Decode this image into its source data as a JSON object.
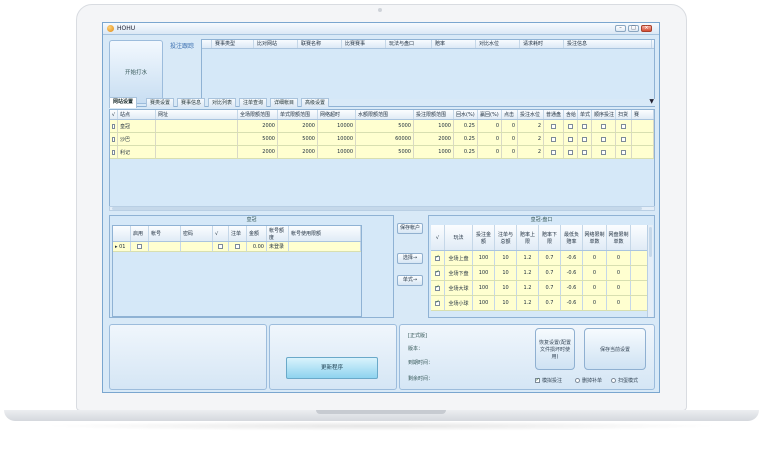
{
  "window": {
    "title": "HOHU",
    "minimize": "–",
    "maximize": "□",
    "close": "×"
  },
  "start_button": {
    "label": "开始打水"
  },
  "tracking": {
    "label": "投注跟踪",
    "columns": [
      "赛事类型",
      "比对网站",
      "联赛名称",
      "比赛赛事",
      "玩法与盘口",
      "赔率",
      "对比水位",
      "请求耗时",
      "投注信息"
    ]
  },
  "tabs": [
    "网站设置",
    "赛类设置",
    "赛事信息",
    "对比列表",
    "注单查询",
    "详细帐目",
    "高级设置"
  ],
  "site_grid": {
    "columns": [
      "√",
      "站点",
      "网址",
      "全场限额范围",
      "单式限额范围",
      "网络超时",
      "水额限额范围",
      "投注限额范围",
      "回水(%)",
      "赢回(%)",
      "点击",
      "投注水位",
      "普通盘",
      "含给",
      "单式",
      "顺序投注",
      "扫货",
      "赛"
    ],
    "rows": [
      {
        "checked": false,
        "site": "皇冠",
        "url": "",
        "full_limit": "2000",
        "single_limit": "2000",
        "timeout": "10000",
        "water_limit": "5000",
        "bet_limit": "1000",
        "rebate": "0.25",
        "winback": "0",
        "click": "0",
        "level": "2"
      },
      {
        "checked": false,
        "site": "沙巴",
        "url": "",
        "full_limit": "5000",
        "single_limit": "5000",
        "timeout": "10000",
        "water_limit": "60000",
        "bet_limit": "2000",
        "rebate": "0.25",
        "winback": "0",
        "click": "0",
        "level": "2"
      },
      {
        "checked": false,
        "site": "利记",
        "url": "",
        "full_limit": "2000",
        "single_limit": "2000",
        "timeout": "10000",
        "water_limit": "5000",
        "bet_limit": "1000",
        "rebate": "0.25",
        "winback": "0",
        "click": "0",
        "level": "2"
      }
    ]
  },
  "account_panel": {
    "title": "皇冠",
    "columns": [
      "启用",
      "帐号",
      "密码",
      "√",
      "注单",
      "金额",
      "帐号额度",
      "帐号使用限额"
    ],
    "rows": [
      {
        "marker": "▸",
        "index": "01",
        "enabled": false,
        "account": "",
        "password": "",
        "check": false,
        "note": false,
        "amount": "0.00",
        "quota": "未登录",
        "limit": ""
      }
    ]
  },
  "side_buttons": {
    "save_account": "保存帐户",
    "select": "选择→",
    "single": "单式→"
  },
  "odds_panel": {
    "title": "皇冠-盘口",
    "columns": [
      "√",
      "玩法",
      "投注金额",
      "注单与总额",
      "赔率上限",
      "赔率下限",
      "最低负赔率",
      "网络限制单数",
      "网盘限制单数"
    ],
    "rows": [
      {
        "checked": true,
        "play": "全场上盘",
        "amount": "100",
        "ratio": "10",
        "upper": "1.2",
        "lower": "0.7",
        "min_neg": "-0.6",
        "net_limit": "0",
        "disk_limit": "0"
      },
      {
        "checked": true,
        "play": "全场下盘",
        "amount": "100",
        "ratio": "10",
        "upper": "1.2",
        "lower": "0.7",
        "min_neg": "-0.6",
        "net_limit": "0",
        "disk_limit": "0"
      },
      {
        "checked": true,
        "play": "全场大球",
        "amount": "100",
        "ratio": "10",
        "upper": "1.2",
        "lower": "0.7",
        "min_neg": "-0.6",
        "net_limit": "0",
        "disk_limit": "0"
      },
      {
        "checked": true,
        "play": "全场小球",
        "amount": "100",
        "ratio": "10",
        "upper": "1.2",
        "lower": "0.7",
        "min_neg": "-0.6",
        "net_limit": "0",
        "disk_limit": "0"
      }
    ]
  },
  "bottom": {
    "update_button": "更新程序",
    "edition": "[正式版]",
    "version_label": "版本：",
    "expiry_label": "到期时间：",
    "remaining_label": "剩余时间：",
    "restore_button": "恢复设置(配置文件损坏时使用)",
    "save_button": "保存当前设置",
    "options": [
      {
        "label": "模拟投注",
        "checked": true
      },
      {
        "label": "删掉补单",
        "checked": false
      },
      {
        "label": "扫蛋模式",
        "checked": false
      }
    ]
  }
}
